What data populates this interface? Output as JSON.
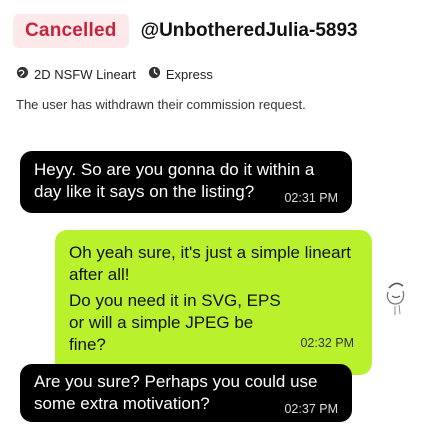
{
  "order": {
    "status": "Cancelled",
    "username": "@UnbotheredJulia-5893",
    "service": "2D NSFW Lineart",
    "delivery": "Express",
    "notice": "The user has withdrawn their commission request."
  },
  "icons": {
    "service_icon": "globe-icon",
    "delivery_icon": "clock-icon"
  },
  "colors": {
    "status_bg": "#fde8ea",
    "status_text": "#c5253c",
    "incoming_bubble": "#000000",
    "outgoing_bubble": "#b9f22d"
  },
  "messages": [
    {
      "sender": "them",
      "lines": [
        "Heyy. So are you gonna do it within a",
        "day like it says on the listing?"
      ],
      "time": "02:31 PM"
    },
    {
      "sender": "me",
      "paragraphs": [
        "Oh yeah sure, it's just a simple lineart after all!",
        "Do you need it in SVG, EPS or will a simple JPEG be fine?"
      ],
      "time": "02:32 PM"
    },
    {
      "sender": "them",
      "lines": [
        "Are you sure? Perhaps you could use",
        "some extra motivation?"
      ],
      "time": "02:37 PM"
    }
  ]
}
